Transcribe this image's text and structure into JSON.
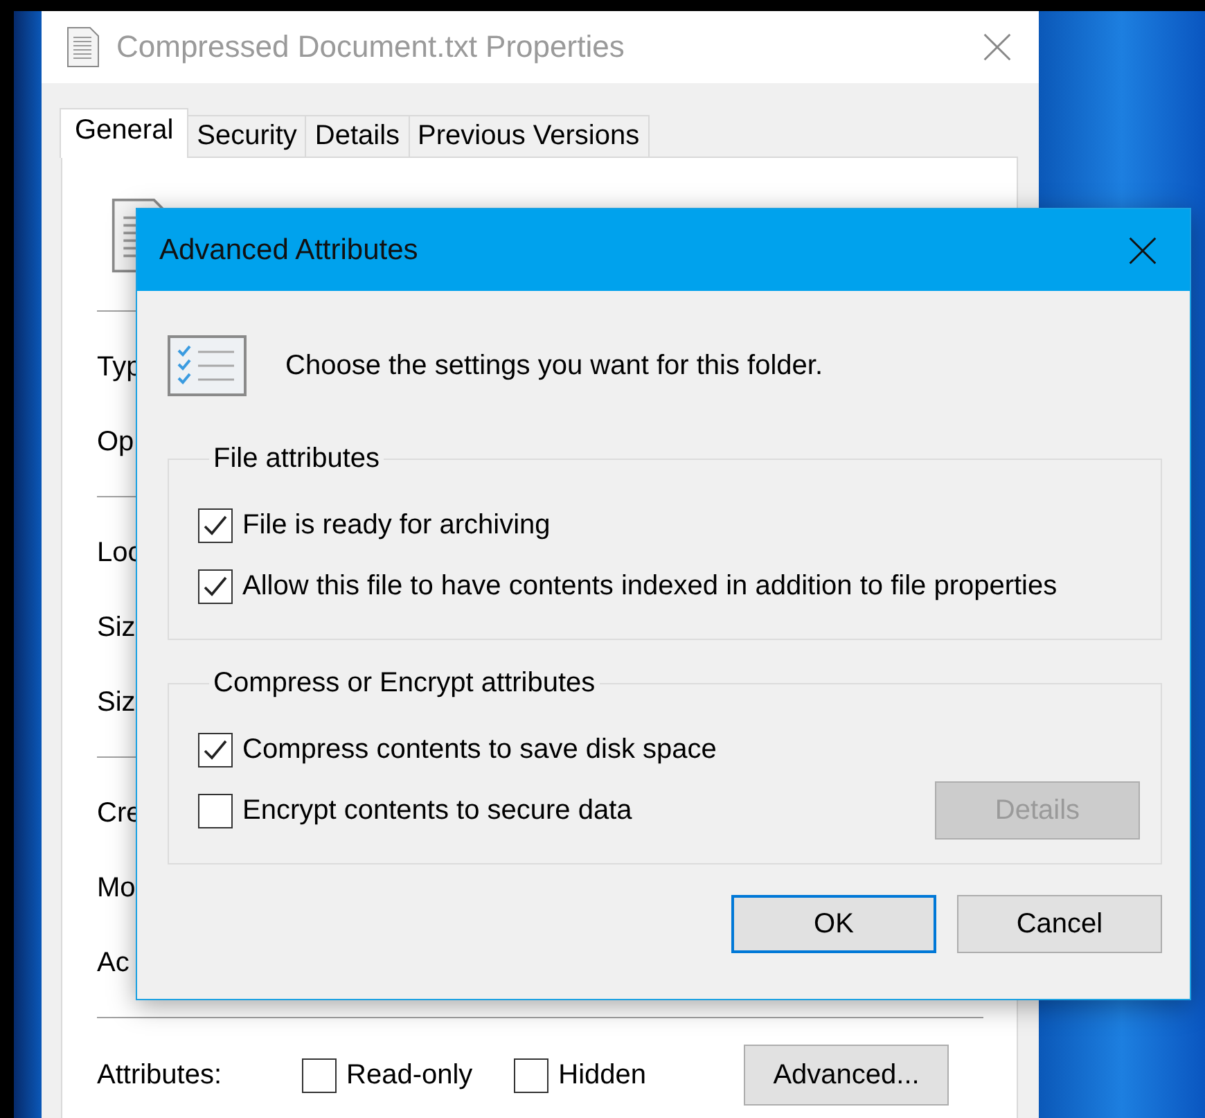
{
  "properties_window": {
    "title": "Compressed Document.txt Properties",
    "tabs": [
      {
        "label": "General",
        "selected": true
      },
      {
        "label": "Security",
        "selected": false
      },
      {
        "label": "Details",
        "selected": false
      },
      {
        "label": "Previous Versions",
        "selected": false
      }
    ],
    "sections": [
      {
        "labels": [
          "Typ",
          "Op"
        ]
      },
      {
        "labels": [
          "Loc",
          "Siz",
          "Siz"
        ]
      },
      {
        "labels": [
          "Cre",
          "Mo",
          "Ac"
        ]
      }
    ],
    "attributes": {
      "label": "Attributes:",
      "checkboxes": [
        {
          "label": "Read-only",
          "checked": false
        },
        {
          "label": "Hidden",
          "checked": false
        }
      ],
      "button": "Advanced..."
    }
  },
  "dialog": {
    "title": "Advanced Attributes",
    "message": "Choose the settings you want for this folder.",
    "groups": [
      {
        "title": "File attributes",
        "options": [
          {
            "label": "File is ready for archiving",
            "checked": true
          },
          {
            "label": "Allow this file to have contents indexed in addition to file properties",
            "checked": true
          }
        ]
      },
      {
        "title": "Compress or Encrypt attributes",
        "options": [
          {
            "label": "Compress contents to save disk space",
            "checked": true
          },
          {
            "label": "Encrypt contents to secure data",
            "checked": false
          }
        ],
        "button": {
          "label": "Details",
          "disabled": true
        }
      }
    ],
    "buttons": [
      {
        "label": "OK",
        "default": true
      },
      {
        "label": "Cancel",
        "default": false
      }
    ]
  }
}
